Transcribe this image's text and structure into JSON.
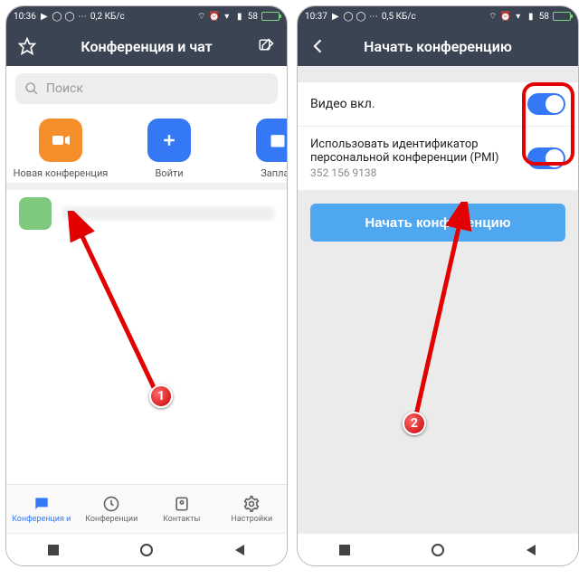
{
  "left": {
    "status": {
      "time": "10:36",
      "net": "0,2 КБ/с",
      "battery": "58"
    },
    "appbar": {
      "title": "Конференция и чат"
    },
    "search": {
      "placeholder": "Поиск"
    },
    "actions": [
      {
        "label": "Новая конференция"
      },
      {
        "label": "Войти"
      },
      {
        "label": "Заплан"
      }
    ],
    "bottomnav": [
      {
        "label": "Конференция и"
      },
      {
        "label": "Конференции"
      },
      {
        "label": "Контакты"
      },
      {
        "label": "Настройки"
      }
    ],
    "marker": "1"
  },
  "right": {
    "status": {
      "time": "10:37",
      "net": "0,5 КБ/с",
      "battery": "58"
    },
    "appbar": {
      "title": "Начать конференцию"
    },
    "settings": {
      "video": {
        "label": "Видео вкл."
      },
      "pmi": {
        "label": "Использовать идентификатор персональной конференции (PMI)",
        "value": "352 156 9138"
      }
    },
    "start_button": "Начать конференцию",
    "marker": "2"
  }
}
